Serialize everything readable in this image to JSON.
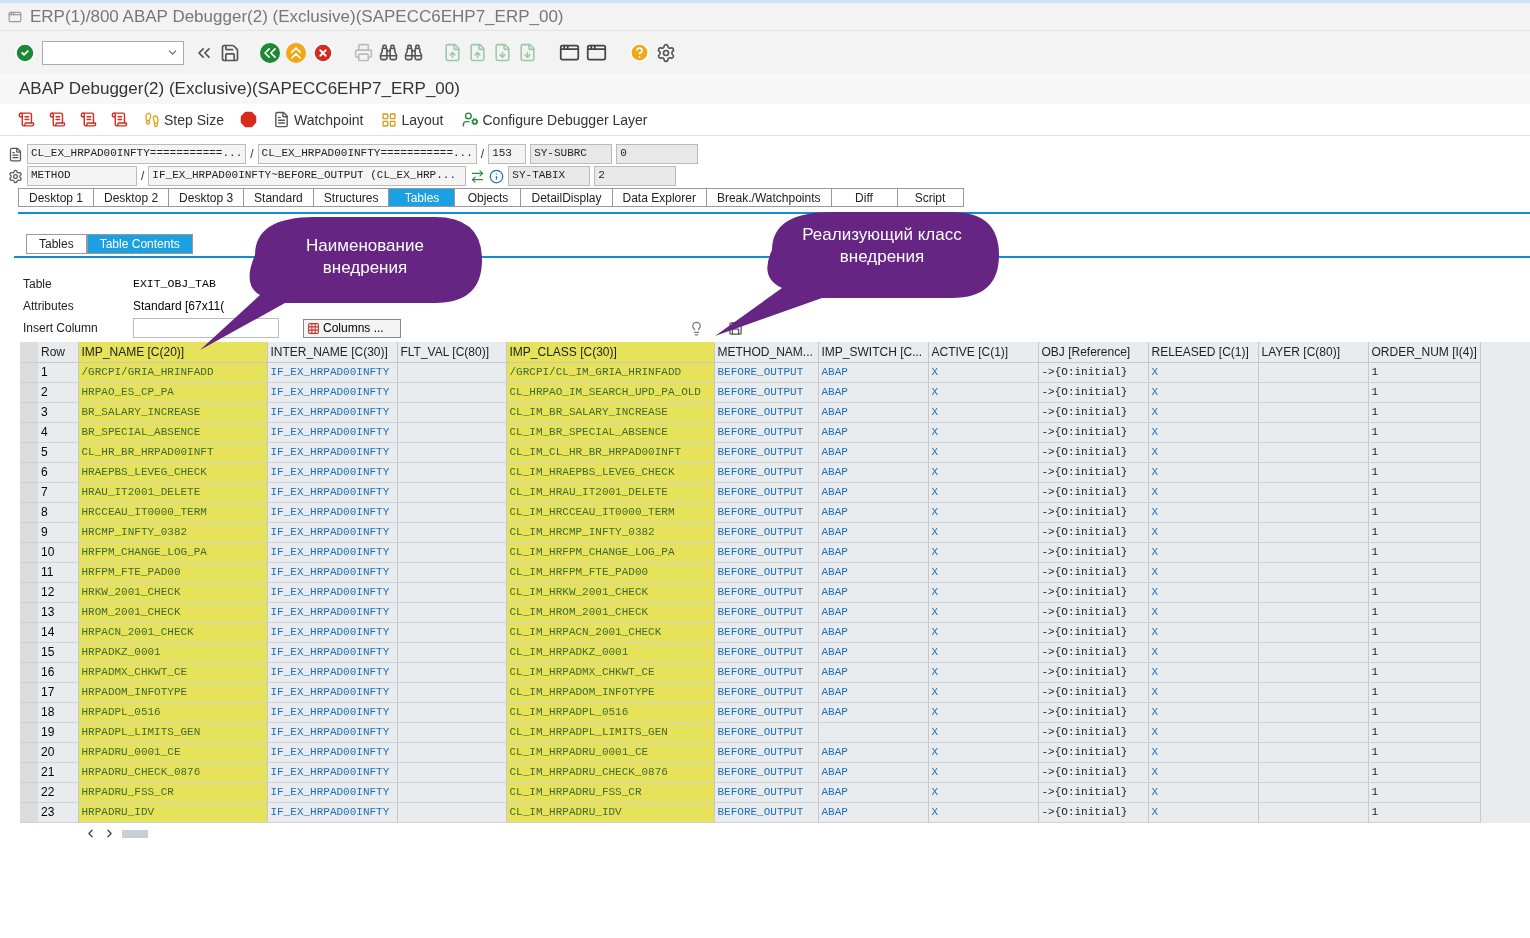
{
  "window": {
    "title": "ERP(1)/800 ABAP Debugger(2)  (Exclusive)(SAPECC6EHP7_ERP_00)"
  },
  "screen_title": "ABAP Debugger(2)  (Exclusive)(SAPECC6EHP7_ERP_00)",
  "debugger_toolbar": [
    {
      "kind": "step"
    },
    {
      "kind": "step_size",
      "label": "Step Size"
    },
    {
      "kind": "stop"
    },
    {
      "kind": "watchpoint",
      "label": "Watchpoint"
    },
    {
      "kind": "layout",
      "label": "Layout"
    },
    {
      "kind": "configure",
      "label": "Configure Debugger Layer"
    }
  ],
  "context": {
    "program": "CL_EX_HRPAD00INFTY===========...",
    "include": "CL_EX_HRPAD00INFTY===========...",
    "line": "153",
    "type": "METHOD",
    "event": "IF_EX_HRPAD00INFTY~BEFORE_OUTPUT (CL_EX_HRP...",
    "separators": [
      "/",
      "/",
      "/"
    ],
    "sysvars": [
      {
        "name": "SY-SUBRC",
        "value": "0"
      },
      {
        "name": "SY-TABIX",
        "value": "2"
      }
    ]
  },
  "tabs": [
    {
      "label": "Desktop 1",
      "selected": false
    },
    {
      "label": "Desktop 2",
      "selected": false
    },
    {
      "label": "Desktop 3",
      "selected": false
    },
    {
      "label": "Standard",
      "selected": false
    },
    {
      "label": "Structures",
      "selected": false
    },
    {
      "label": "Tables",
      "selected": true
    },
    {
      "label": "Objects",
      "selected": false
    },
    {
      "label": "DetailDisplay",
      "selected": false
    },
    {
      "label": "Data Explorer",
      "selected": false
    },
    {
      "label": "Break./Watchpoints",
      "selected": false
    },
    {
      "label": "Diff",
      "selected": false
    },
    {
      "label": "Script",
      "selected": false
    }
  ],
  "subtabs": [
    {
      "label": "Tables",
      "selected": false
    },
    {
      "label": "Table Contents",
      "selected": true
    }
  ],
  "form": {
    "table_label": "Table",
    "table_value": "EXIT_OBJ_TAB",
    "attributes_label": "Attributes",
    "attributes_value": "Standard [67x11(",
    "insert_label": "Insert Column",
    "columns_button": "Columns ..."
  },
  "table": {
    "row_header": "Row",
    "columns": [
      {
        "label": "IMP_NAME [C(20)]",
        "highlighted": true,
        "kind": "char"
      },
      {
        "label": "INTER_NAME [C(30)]",
        "highlighted": false,
        "kind": "char"
      },
      {
        "label": "FLT_VAL [C(80)]",
        "highlighted": false,
        "kind": "char"
      },
      {
        "label": "IMP_CLASS [C(30)]",
        "highlighted": true,
        "kind": "char"
      },
      {
        "label": "METHOD_NAM...",
        "highlighted": false,
        "kind": "char"
      },
      {
        "label": "IMP_SWITCH [C...",
        "highlighted": false,
        "kind": "char"
      },
      {
        "label": "ACTIVE [C(1)]",
        "highlighted": false,
        "kind": "char"
      },
      {
        "label": "OBJ [Reference]",
        "highlighted": false,
        "kind": "ref"
      },
      {
        "label": "RELEASED [C(1)]",
        "highlighted": false,
        "kind": "char"
      },
      {
        "label": "LAYER [C(80)]",
        "highlighted": false,
        "kind": "char"
      },
      {
        "label": "ORDER_NUM [I(4)]",
        "highlighted": false,
        "kind": "ref"
      }
    ],
    "rows": [
      {
        "row": "1",
        "cells": [
          "/GRCPI/GRIA_HRINFADD",
          "IF_EX_HRPAD00INFTY",
          null,
          "/GRCPI/CL_IM_GRIA_HRINFADD",
          "BEFORE_OUTPUT",
          "ABAP",
          "X",
          "->{O:initial}",
          "X",
          null,
          "1"
        ]
      },
      {
        "row": "2",
        "cells": [
          "HRPAO_ES_CP_PA",
          "IF_EX_HRPAD00INFTY",
          null,
          "CL_HRPAO_IM_SEARCH_UPD_PA_OLD",
          "BEFORE_OUTPUT",
          "ABAP",
          "X",
          "->{O:initial}",
          "X",
          null,
          "1"
        ]
      },
      {
        "row": "3",
        "cells": [
          "BR_SALARY_INCREASE",
          "IF_EX_HRPAD00INFTY",
          null,
          "CL_IM_BR_SALARY_INCREASE",
          "BEFORE_OUTPUT",
          "ABAP",
          "X",
          "->{O:initial}",
          "X",
          null,
          "1"
        ]
      },
      {
        "row": "4",
        "cells": [
          "BR_SPECIAL_ABSENCE",
          "IF_EX_HRPAD00INFTY",
          null,
          "CL_IM_BR_SPECIAL_ABSENCE",
          "BEFORE_OUTPUT",
          "ABAP",
          "X",
          "->{O:initial}",
          "X",
          null,
          "1"
        ]
      },
      {
        "row": "5",
        "cells": [
          "CL_HR_BR_HRPAD00INFT",
          "IF_EX_HRPAD00INFTY",
          null,
          "CL_IM_CL_HR_BR_HRPAD00INFT",
          "BEFORE_OUTPUT",
          "ABAP",
          "X",
          "->{O:initial}",
          "X",
          null,
          "1"
        ]
      },
      {
        "row": "6",
        "cells": [
          "HRAEPBS_LEVEG_CHECK",
          "IF_EX_HRPAD00INFTY",
          null,
          "CL_IM_HRAEPBS_LEVEG_CHECK",
          "BEFORE_OUTPUT",
          "ABAP",
          "X",
          "->{O:initial}",
          "X",
          null,
          "1"
        ]
      },
      {
        "row": "7",
        "cells": [
          "HRAU_IT2001_DELETE",
          "IF_EX_HRPAD00INFTY",
          null,
          "CL_IM_HRAU_IT2001_DELETE",
          "BEFORE_OUTPUT",
          "ABAP",
          "X",
          "->{O:initial}",
          "X",
          null,
          "1"
        ]
      },
      {
        "row": "8",
        "cells": [
          "HRCCEAU_IT0000_TERM",
          "IF_EX_HRPAD00INFTY",
          null,
          "CL_IM_HRCCEAU_IT0000_TERM",
          "BEFORE_OUTPUT",
          "ABAP",
          "X",
          "->{O:initial}",
          "X",
          null,
          "1"
        ]
      },
      {
        "row": "9",
        "cells": [
          "HRCMP_INFTY_0382",
          "IF_EX_HRPAD00INFTY",
          null,
          "CL_IM_HRCMP_INFTY_0382",
          "BEFORE_OUTPUT",
          "ABAP",
          "X",
          "->{O:initial}",
          "X",
          null,
          "1"
        ]
      },
      {
        "row": "10",
        "cells": [
          "HRFPM_CHANGE_LOG_PA",
          "IF_EX_HRPAD00INFTY",
          null,
          "CL_IM_HRFPM_CHANGE_LOG_PA",
          "BEFORE_OUTPUT",
          "ABAP",
          "X",
          "->{O:initial}",
          "X",
          null,
          "1"
        ]
      },
      {
        "row": "11",
        "cells": [
          "HRFPM_FTE_PAD00",
          "IF_EX_HRPAD00INFTY",
          null,
          "CL_IM_HRFPM_FTE_PAD00",
          "BEFORE_OUTPUT",
          "ABAP",
          "X",
          "->{O:initial}",
          "X",
          null,
          "1"
        ]
      },
      {
        "row": "12",
        "cells": [
          "HRKW_2001_CHECK",
          "IF_EX_HRPAD00INFTY",
          null,
          "CL_IM_HRKW_2001_CHECK",
          "BEFORE_OUTPUT",
          "ABAP",
          "X",
          "->{O:initial}",
          "X",
          null,
          "1"
        ]
      },
      {
        "row": "13",
        "cells": [
          "HROM_2001_CHECK",
          "IF_EX_HRPAD00INFTY",
          null,
          "CL_IM_HROM_2001_CHECK",
          "BEFORE_OUTPUT",
          "ABAP",
          "X",
          "->{O:initial}",
          "X",
          null,
          "1"
        ]
      },
      {
        "row": "14",
        "cells": [
          "HRPACN_2001_CHECK",
          "IF_EX_HRPAD00INFTY",
          null,
          "CL_IM_HRPACN_2001_CHECK",
          "BEFORE_OUTPUT",
          "ABAP",
          "X",
          "->{O:initial}",
          "X",
          null,
          "1"
        ]
      },
      {
        "row": "15",
        "cells": [
          "HRPADKZ_0001",
          "IF_EX_HRPAD00INFTY",
          null,
          "CL_IM_HRPADKZ_0001",
          "BEFORE_OUTPUT",
          "ABAP",
          "X",
          "->{O:initial}",
          "X",
          null,
          "1"
        ]
      },
      {
        "row": "16",
        "cells": [
          "HRPADMX_CHKWT_CE",
          "IF_EX_HRPAD00INFTY",
          null,
          "CL_IM_HRPADMX_CHKWT_CE",
          "BEFORE_OUTPUT",
          "ABAP",
          "X",
          "->{O:initial}",
          "X",
          null,
          "1"
        ]
      },
      {
        "row": "17",
        "cells": [
          "HRPADOM_INFOTYPE",
          "IF_EX_HRPAD00INFTY",
          null,
          "CL_IM_HRPADOM_INFOTYPE",
          "BEFORE_OUTPUT",
          "ABAP",
          "X",
          "->{O:initial}",
          "X",
          null,
          "1"
        ]
      },
      {
        "row": "18",
        "cells": [
          "HRPADPL_0516",
          "IF_EX_HRPAD00INFTY",
          null,
          "CL_IM_HRPADPL_0516",
          "BEFORE_OUTPUT",
          "ABAP",
          "X",
          "->{O:initial}",
          "X",
          null,
          "1"
        ]
      },
      {
        "row": "19",
        "cells": [
          "HRPADPL_LIMITS_GEN",
          "IF_EX_HRPAD00INFTY",
          null,
          "CL_IM_HRPADPL_LIMITS_GEN",
          "BEFORE_OUTPUT",
          null,
          "X",
          "->{O:initial}",
          "X",
          null,
          "1"
        ]
      },
      {
        "row": "20",
        "cells": [
          "HRPADRU_0001_CE",
          "IF_EX_HRPAD00INFTY",
          null,
          "CL_IM_HRPADRU_0001_CE",
          "BEFORE_OUTPUT",
          "ABAP",
          "X",
          "->{O:initial}",
          "X",
          null,
          "1"
        ]
      },
      {
        "row": "21",
        "cells": [
          "HRPADRU_CHECK_0876",
          "IF_EX_HRPAD00INFTY",
          null,
          "CL_IM_HRPADRU_CHECK_0876",
          "BEFORE_OUTPUT",
          "ABAP",
          "X",
          "->{O:initial}",
          "X",
          null,
          "1"
        ]
      },
      {
        "row": "22",
        "cells": [
          "HRPADRU_FSS_CR",
          "IF_EX_HRPAD00INFTY",
          null,
          "CL_IM_HRPADRU_FSS_CR",
          "BEFORE_OUTPUT",
          "ABAP",
          "X",
          "->{O:initial}",
          "X",
          null,
          "1"
        ]
      },
      {
        "row": "23",
        "cells": [
          "HRPADRU_IDV",
          "IF_EX_HRPAD00INFTY",
          null,
          "CL_IM_HRPADRU_IDV",
          "BEFORE_OUTPUT",
          "ABAP",
          "X",
          "->{O:initial}",
          "X",
          null,
          "1"
        ]
      }
    ]
  },
  "callouts": [
    {
      "text": "Наименование внедрения"
    },
    {
      "text": "Реализующий класс внедрения"
    }
  ]
}
